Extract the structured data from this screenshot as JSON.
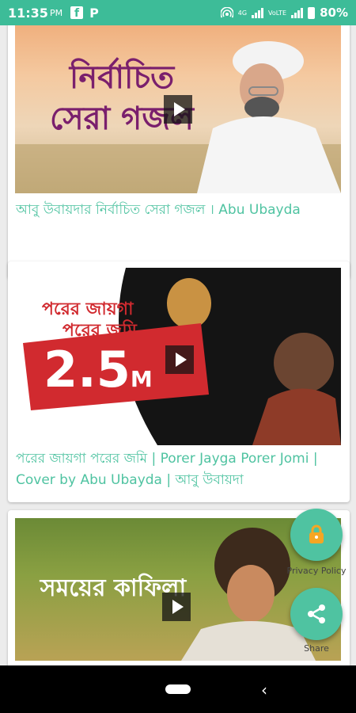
{
  "status_bar": {
    "time": "11:35",
    "ampm": "PM",
    "app_icon_1": "f",
    "app_icon_2": "P",
    "net_label": "4G",
    "volte_label": "VoLTE",
    "battery": "80%"
  },
  "videos": [
    {
      "thumbnail_text": "নির্বাচিত সেরা গজল",
      "title": "আবু উবায়দার নির্বাচিত সেরা গজল । Abu Ubayda"
    },
    {
      "thumbnail_text_1": "পরের জায়গা",
      "thumbnail_text_2": "পরের জমি",
      "thumbnail_badge": "2.5",
      "thumbnail_badge_suffix": "M",
      "title": "পরের জায়গা পরের জমি | Porer Jayga Porer Jomi | Cover by Abu Ubayda | আবু উবায়দা"
    },
    {
      "thumbnail_text": "সময়ের কাফিলা"
    }
  ],
  "fab": {
    "privacy_label": "Privacy Policy",
    "share_label": "Share"
  },
  "colors": {
    "accent": "#4fc3a1",
    "status_bar": "#3dbc98"
  }
}
